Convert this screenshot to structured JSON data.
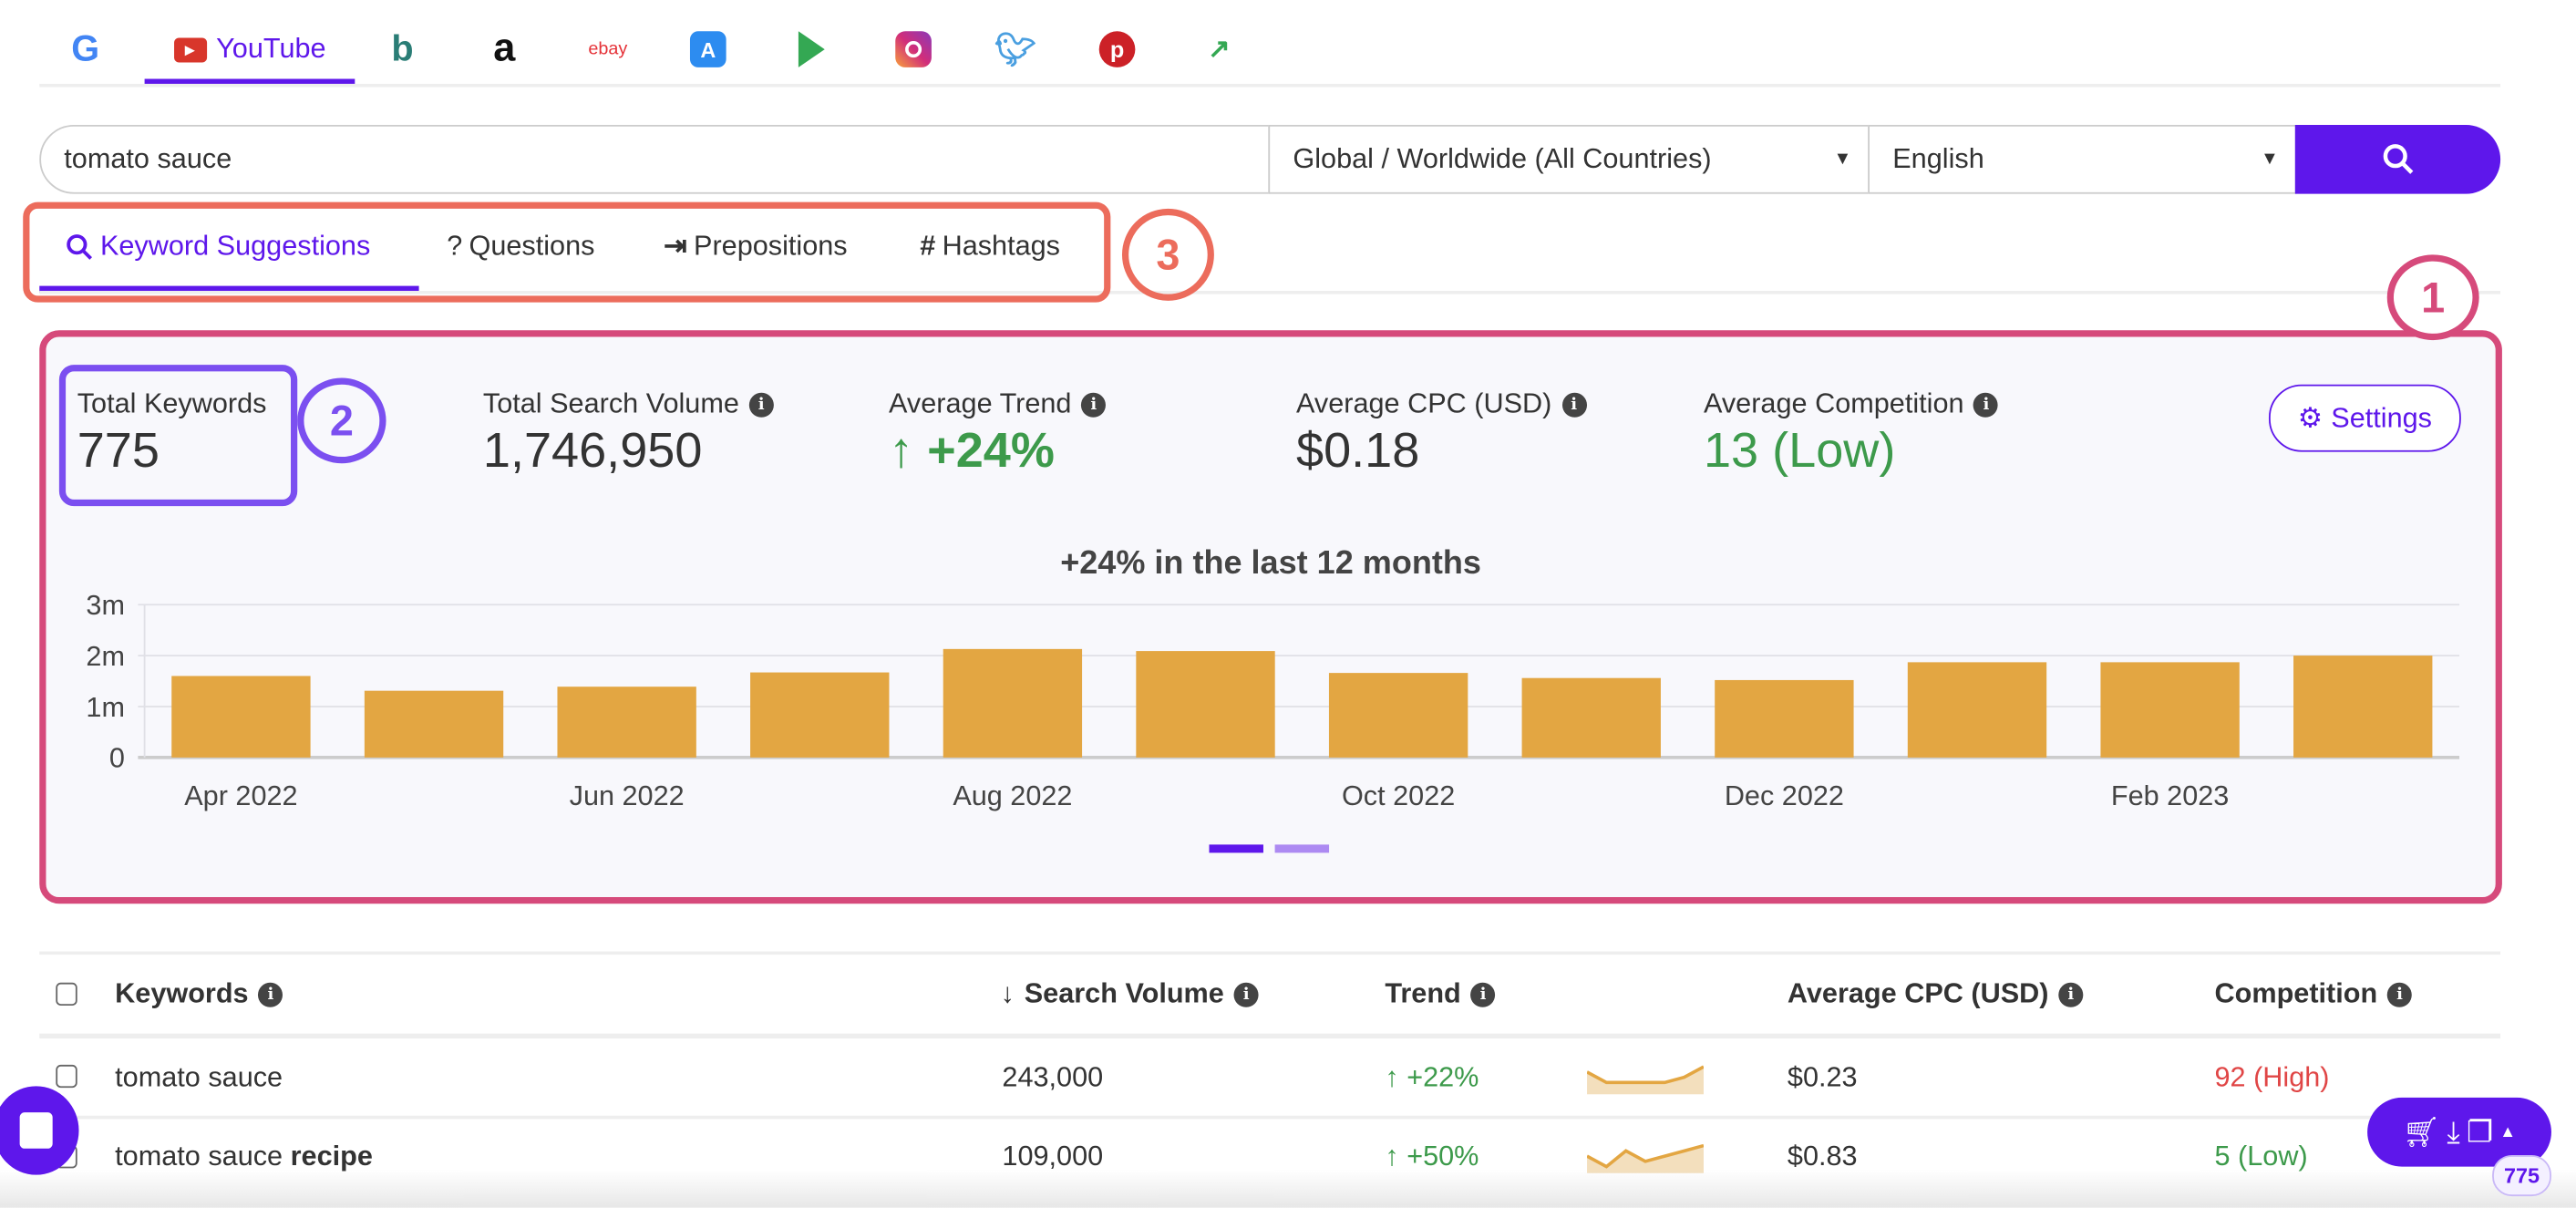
{
  "engines": [
    {
      "name": "google",
      "label": ""
    },
    {
      "name": "youtube",
      "label": "YouTube",
      "active": true
    },
    {
      "name": "bing",
      "label": ""
    },
    {
      "name": "amazon",
      "label": ""
    },
    {
      "name": "ebay",
      "label": "ebay"
    },
    {
      "name": "app-store",
      "label": ""
    },
    {
      "name": "play-store",
      "label": ""
    },
    {
      "name": "instagram",
      "label": ""
    },
    {
      "name": "twitter",
      "label": ""
    },
    {
      "name": "pinterest",
      "label": ""
    },
    {
      "name": "trends",
      "label": ""
    }
  ],
  "search": {
    "query": "tomato sauce",
    "region": "Global / Worldwide (All Countries)",
    "language": "English",
    "button_icon": "search-icon"
  },
  "subtabs": [
    {
      "label": "Keyword Suggestions",
      "icon": "search-icon",
      "active": true
    },
    {
      "label": "Questions",
      "icon": "question-icon"
    },
    {
      "label": "Prepositions",
      "icon": "indent-icon"
    },
    {
      "label": "Hashtags",
      "icon": "hash-icon"
    }
  ],
  "annotations": {
    "one": "1",
    "two": "2",
    "three": "3"
  },
  "stats": {
    "total_keywords": {
      "label": "Total Keywords",
      "value": "775"
    },
    "total_volume": {
      "label": "Total Search Volume",
      "value": "1,746,950"
    },
    "avg_trend": {
      "label": "Average Trend",
      "value": "+24%"
    },
    "avg_cpc": {
      "label": "Average CPC (USD)",
      "value": "$0.18"
    },
    "avg_comp": {
      "label": "Average Competition",
      "value": "13 (Low)"
    },
    "settings_label": "Settings"
  },
  "colors": {
    "accent": "#5e17eb",
    "bar": "#e3a642",
    "green": "#3d9a4b",
    "red": "#e04646",
    "annot1": "#d64a7b",
    "annot2": "#7b4ff0",
    "annot3": "#ec6c5c"
  },
  "chart_data": {
    "type": "bar",
    "title": "+24% in the last 12 months",
    "categories": [
      "Apr 2022",
      "May 2022",
      "Jun 2022",
      "Jul 2022",
      "Aug 2022",
      "Sep 2022",
      "Oct 2022",
      "Nov 2022",
      "Dec 2022",
      "Jan 2023",
      "Feb 2023",
      "Mar 2023"
    ],
    "x_tick_labels": [
      "Apr 2022",
      "Jun 2022",
      "Aug 2022",
      "Oct 2022",
      "Dec 2022",
      "Feb 2023"
    ],
    "values": [
      1600000,
      1310000,
      1390000,
      1670000,
      2130000,
      2090000,
      1660000,
      1560000,
      1520000,
      1870000,
      1870000,
      2000000
    ],
    "y_ticks": [
      "0",
      "1m",
      "2m",
      "3m"
    ],
    "ylim": [
      0,
      3000000
    ],
    "grid": true,
    "pager": {
      "pages": 2,
      "current": 1
    }
  },
  "table": {
    "headers": {
      "keywords": "Keywords",
      "volume": "Search Volume",
      "trend": "Trend",
      "cpc": "Average CPC (USD)",
      "competition": "Competition"
    },
    "rows": [
      {
        "kw": "tomato sauce",
        "kw_bold": "",
        "volume": "243,000",
        "trend": "+22%",
        "spark": [
          3,
          1,
          1,
          1,
          1,
          2,
          4
        ],
        "cpc": "$0.23",
        "comp": "92 (High)",
        "comp_level": "high"
      },
      {
        "kw": "tomato sauce ",
        "kw_bold": "recipe",
        "volume": "109,000",
        "trend": "+50%",
        "spark": [
          2,
          0,
          3,
          1,
          2,
          3,
          4
        ],
        "cpc": "$0.83",
        "comp": "5 (Low)",
        "comp_level": "low"
      }
    ]
  },
  "floating": {
    "count": "775"
  }
}
